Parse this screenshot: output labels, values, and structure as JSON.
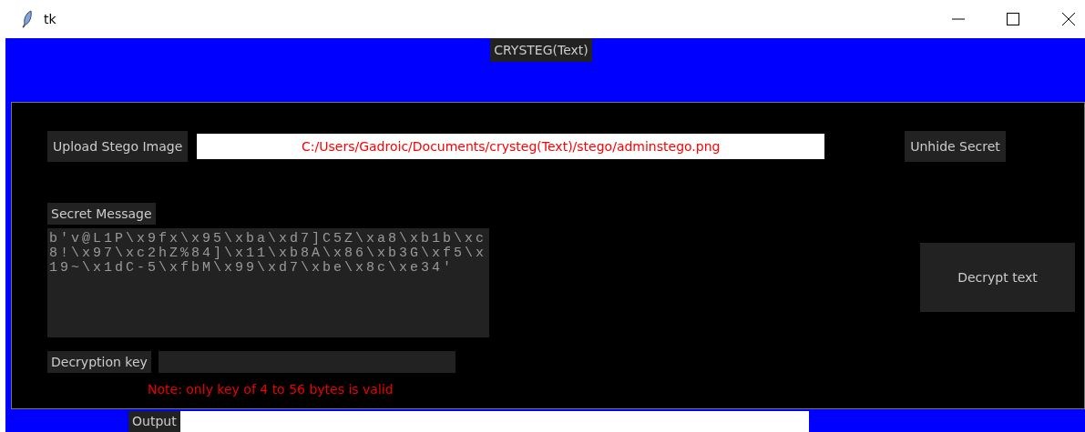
{
  "window": {
    "title": "tk"
  },
  "header": {
    "title": "CRYSTEG(Text)"
  },
  "upload": {
    "button": "Upload Stego Image",
    "path": "C:/Users/Gadroic/Documents/crysteg(Text)/stego/adminstego.png",
    "action": "Unhide Secret"
  },
  "secret": {
    "label": "Secret Message",
    "value": "b'v@L1P\\x9fx\\x95\\xba\\xd7]C5Z\\xa8\\xb1b\\xc8!\\x97\\xc2hZ%84]\\x11\\xb8A\\x86\\xb3G\\xf5\\x19~\\x1dC-5\\xfbM\\x99\\xd7\\xbe\\x8c\\xe34'",
    "action": "Decrypt text"
  },
  "key": {
    "label": "Decryption key",
    "note": "Note: only key of 4 to 56 bytes is valid"
  },
  "output": {
    "label": "Output"
  }
}
